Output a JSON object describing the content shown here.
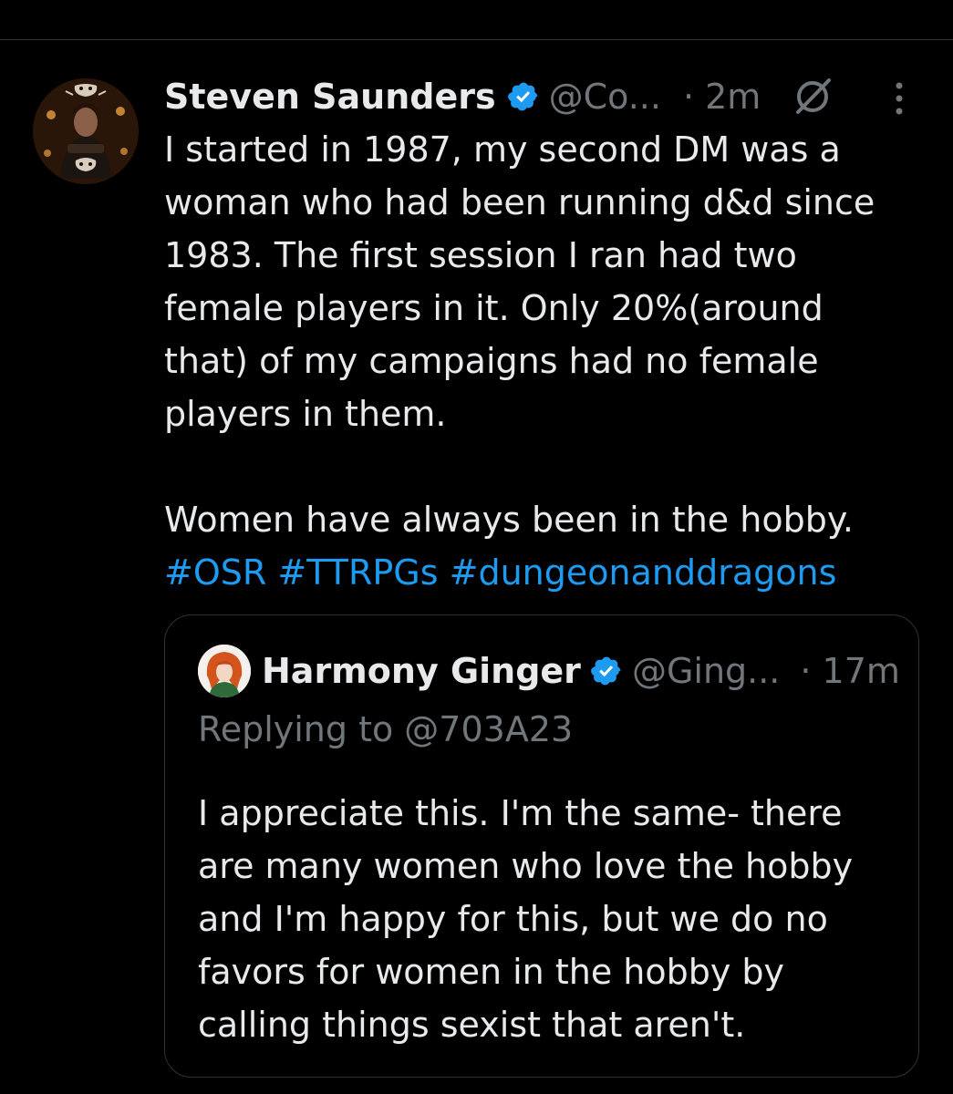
{
  "tweet": {
    "author_name": "Steven Saunders",
    "handle": "@Co...",
    "time": "· 2m",
    "text": "I started in 1987, my second DM was a\nwoman who had been running d&d since\n1983. The first session I ran had two\nfemale players in it. Only 20%(around\nthat) of my campaigns had no female\nplayers in them.\n\nWomen have always been in the hobby.",
    "hashtags": [
      "#OSR",
      "#TTRPGs",
      "#dungeonanddragons"
    ],
    "icons": {
      "verified": "verified-badge-icon",
      "reply_restricted": "replies-restricted-icon",
      "more": "more-options-icon"
    }
  },
  "quote": {
    "author_name": "Harmony Ginger",
    "handle": "@Ging...",
    "time": "· 17m",
    "replying_to": "Replying to @703A23",
    "text": "I appreciate this. I'm the same- there\nare many women who love the hobby\nand I'm happy for this, but we do no\nfavors for women in the hobby by\ncalling things sexist that aren't."
  },
  "colors": {
    "background": "#000000",
    "text": "#e7e9ea",
    "muted": "#71767b",
    "accent": "#1d9bf0",
    "border": "#2f3336"
  }
}
